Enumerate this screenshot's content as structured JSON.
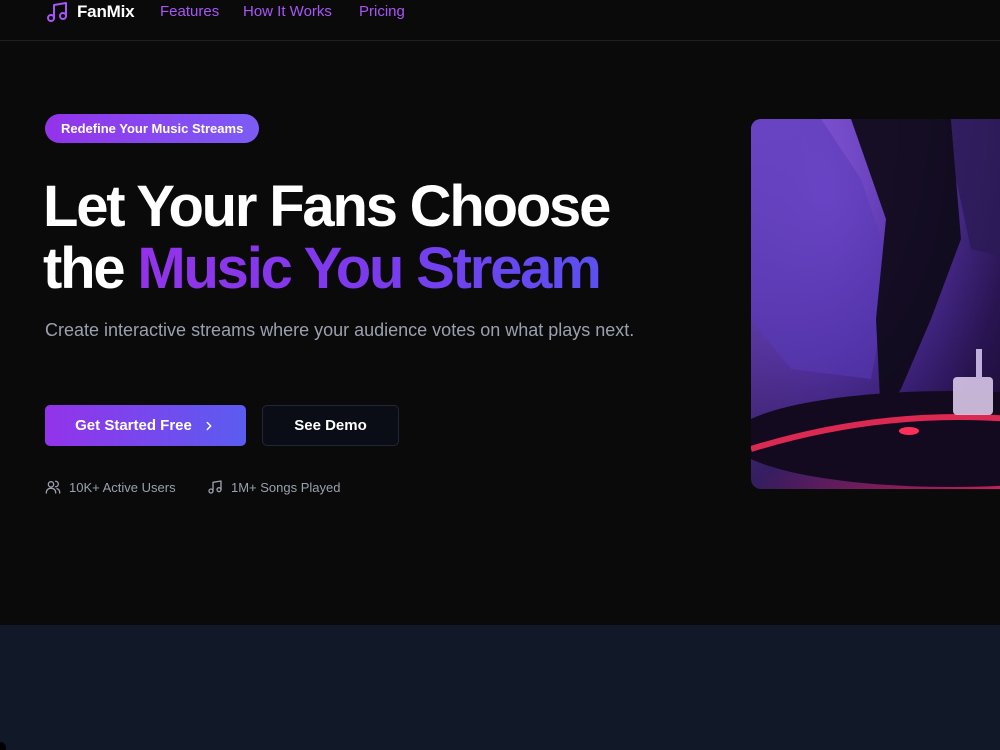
{
  "nav": {
    "brand": "FanMix",
    "links": [
      "Features",
      "How It Works",
      "Pricing"
    ]
  },
  "hero": {
    "badge": "Redefine Your Music Streams",
    "title_line1": "Let Your Fans Choose",
    "title_line2_plain": "the",
    "title_line2_highlight": "Music You Stream",
    "subtitle": "Create interactive streams where your audience votes on what plays next.",
    "primary_cta": "Get Started Free",
    "secondary_cta": "See Demo",
    "stats": [
      "10K+ Active Users",
      "1M+ Songs Played"
    ]
  },
  "icons": {
    "brand": "music-note-icon",
    "cta": "chevron-right-icon",
    "stat_users": "users-icon",
    "stat_songs": "music-note-icon"
  },
  "colors": {
    "accent": "#a855f7",
    "gradient_start": "#9333ea",
    "gradient_end": "#5b5cf0",
    "background": "#0a0a0b",
    "section_bg": "#111827",
    "muted_text": "#9aa0ad"
  }
}
